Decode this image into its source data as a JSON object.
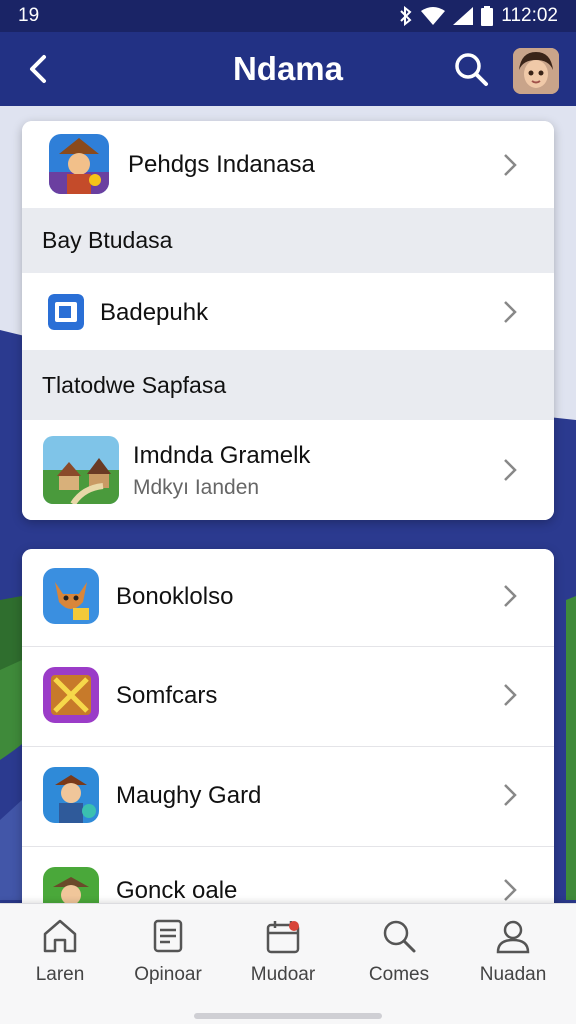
{
  "status": {
    "time": "19",
    "clock": "112:02"
  },
  "appbar": {
    "title": "Ndama"
  },
  "card1": {
    "row1": {
      "title": "Pehdgs Indanasa"
    },
    "section1": "Bay Btudasa",
    "row2": {
      "title": "Badepuhk"
    },
    "section2": "Tlatodwe Sapfasa",
    "row3": {
      "title": "Imdnda Gramelk",
      "subtitle": "Mdkyı Ianden"
    }
  },
  "card2": {
    "items": [
      {
        "title": "Bonoklolso"
      },
      {
        "title": "Somfcars"
      },
      {
        "title": "Maughy Gard"
      },
      {
        "title": "Gonck oale"
      }
    ]
  },
  "nav": {
    "items": [
      {
        "label": "Laren",
        "icon": "home-icon"
      },
      {
        "label": "Opinoar",
        "icon": "document-icon"
      },
      {
        "label": "Mudoar",
        "icon": "calendar-icon"
      },
      {
        "label": "Comes",
        "icon": "search-icon"
      },
      {
        "label": "Nuadan",
        "icon": "person-icon"
      }
    ]
  },
  "colors": {
    "appbar": "#223184",
    "background": "#1d2a78",
    "card": "#ffffff",
    "section": "#e9ebf0"
  }
}
